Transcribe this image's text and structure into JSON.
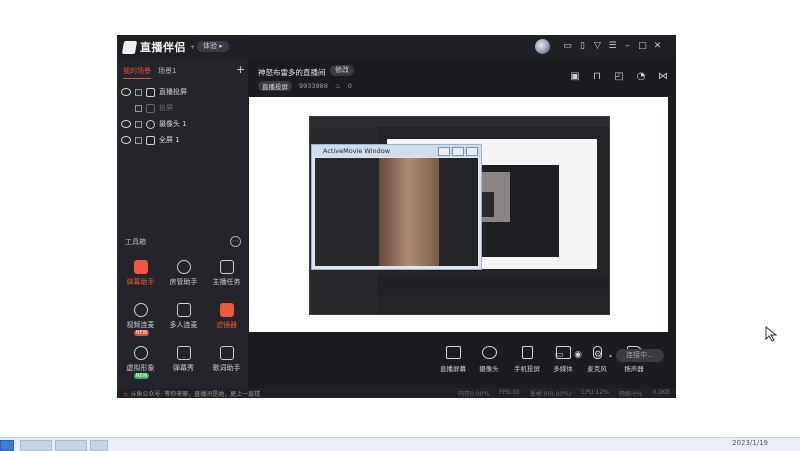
{
  "app": {
    "logo_text": "直播伴侣",
    "version_label": "体验",
    "window_controls": [
      "消息",
      "通知",
      "设置",
      "菜单",
      "最小化",
      "最大化",
      "关闭"
    ]
  },
  "scenes": {
    "tabs": [
      "我的场景",
      "场景1"
    ],
    "sources": [
      {
        "label": "直播投屏",
        "dim": false
      },
      {
        "label": "投屏",
        "dim": true
      },
      {
        "label": "摄像头 1",
        "dim": false
      },
      {
        "label": "全屏 1",
        "dim": false
      }
    ]
  },
  "tools": {
    "title": "工具箱",
    "items": [
      {
        "label": "弹幕助手",
        "hot": true,
        "badge": ""
      },
      {
        "label": "房管助手",
        "hot": false,
        "badge": ""
      },
      {
        "label": "主播任务",
        "hot": false,
        "badge": ""
      },
      {
        "label": "视频连麦",
        "hot": false,
        "badge": "NEW"
      },
      {
        "label": "多人连麦",
        "hot": false,
        "badge": ""
      },
      {
        "label": "滤镜器",
        "hot": true,
        "badge": ""
      },
      {
        "label": "虚拟形象",
        "hot": false,
        "badge": "NEW"
      },
      {
        "label": "弹幕秀",
        "hot": false,
        "badge": ""
      },
      {
        "label": "歌词助手",
        "hot": false,
        "badge": ""
      }
    ]
  },
  "room": {
    "title": "神怒布雷多的直播间",
    "edit_label": "修改",
    "category": "直播投屏",
    "room_id": "9933988",
    "heat": "0"
  },
  "preview": {
    "popup_title": "ActiveMovie Window"
  },
  "controls": {
    "buttons": [
      "直播屏幕",
      "摄像头",
      "手机投屏",
      "多媒体",
      "麦克风",
      "扬声器"
    ],
    "live_label": "连接中..."
  },
  "status": {
    "notice_prefix": "斗鱼公众号:",
    "notice": "等你来聊，直播间是她，更上一层楼",
    "metrics": [
      "内存0.00%",
      "FPS:30",
      "丢帧:0(0.00%)",
      "CPU:12%",
      "网络:0%",
      "0.0KB"
    ]
  },
  "taskbar": {
    "clock": "2023/1/19"
  }
}
